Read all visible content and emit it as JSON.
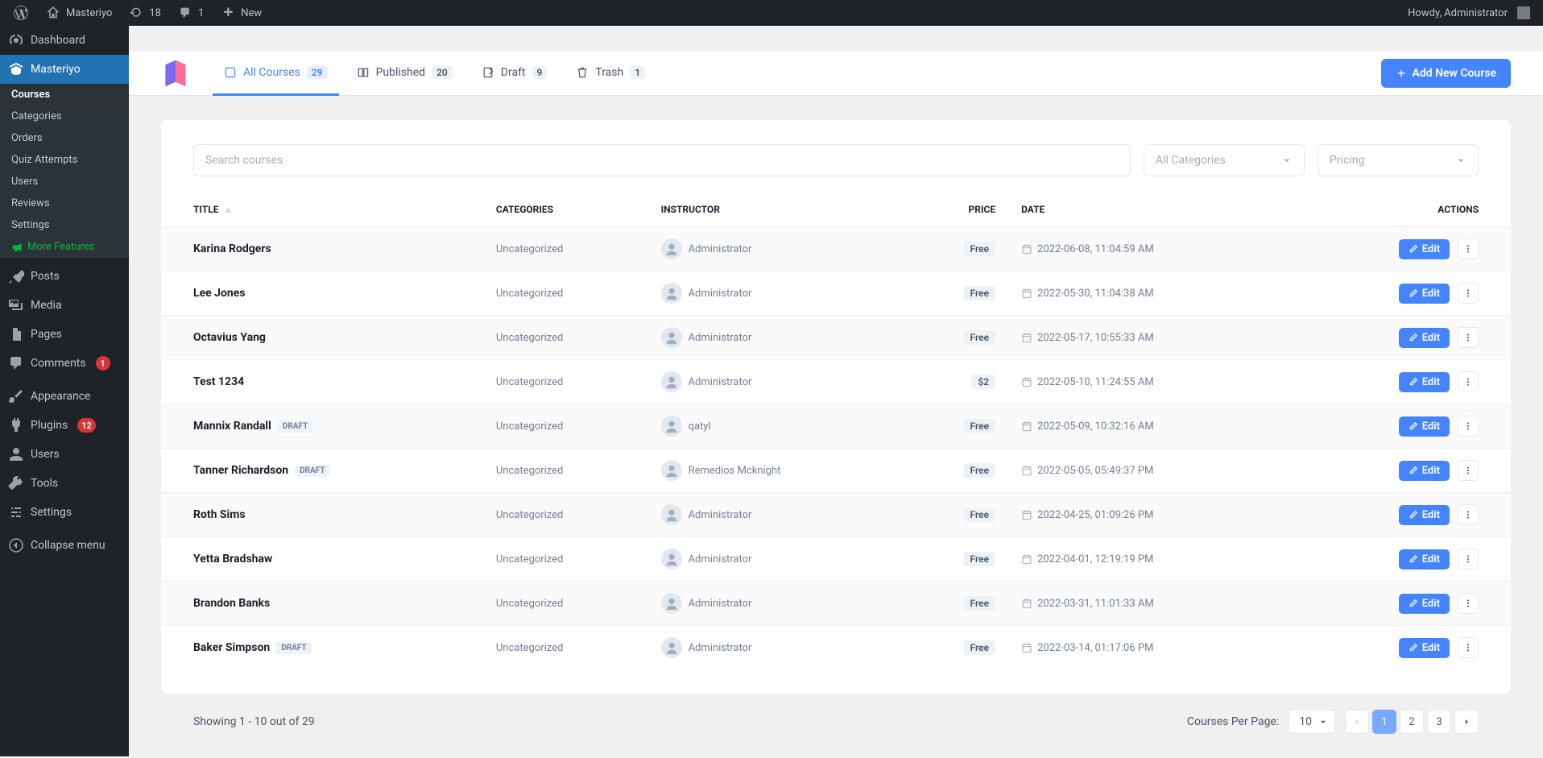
{
  "adminbar": {
    "site": "Masteriyo",
    "updates": "18",
    "comments": "1",
    "new": "New",
    "howdy": "Howdy, Administrator"
  },
  "sidebar": {
    "dashboard": "Dashboard",
    "masteriyo": "Masteriyo",
    "sub": {
      "courses": "Courses",
      "categories": "Categories",
      "orders": "Orders",
      "quiz": "Quiz Attempts",
      "users": "Users",
      "reviews": "Reviews",
      "settings": "Settings",
      "more": "More Features"
    },
    "posts": "Posts",
    "media": "Media",
    "pages": "Pages",
    "comments": "Comments",
    "comments_count": "1",
    "appearance": "Appearance",
    "plugins": "Plugins",
    "plugins_count": "12",
    "wpusers": "Users",
    "tools": "Tools",
    "wpsettings": "Settings",
    "collapse": "Collapse menu"
  },
  "tabs": {
    "all": {
      "label": "All Courses",
      "count": "29"
    },
    "published": {
      "label": "Published",
      "count": "20"
    },
    "draft": {
      "label": "Draft",
      "count": "9"
    },
    "trash": {
      "label": "Trash",
      "count": "1"
    }
  },
  "addNew": "Add New Course",
  "filters": {
    "search_placeholder": "Search courses",
    "categories": "All Categories",
    "pricing": "Pricing"
  },
  "columns": {
    "title": "TITLE",
    "categories": "CATEGORIES",
    "instructor": "INSTRUCTOR",
    "price": "PRICE",
    "date": "DATE",
    "actions": "ACTIONS"
  },
  "rows": [
    {
      "title": "Karina Rodgers",
      "draft": false,
      "cat": "Uncategorized",
      "instructor": "Administrator",
      "price": "Free",
      "date": "2022-06-08, 11:04:59 AM"
    },
    {
      "title": "Lee Jones",
      "draft": false,
      "cat": "Uncategorized",
      "instructor": "Administrator",
      "price": "Free",
      "date": "2022-05-30, 11:04:38 AM"
    },
    {
      "title": "Octavius Yang",
      "draft": false,
      "cat": "Uncategorized",
      "instructor": "Administrator",
      "price": "Free",
      "date": "2022-05-17, 10:55:33 AM"
    },
    {
      "title": "Test 1234",
      "draft": false,
      "cat": "Uncategorized",
      "instructor": "Administrator",
      "price": "$2",
      "date": "2022-05-10, 11:24:55 AM"
    },
    {
      "title": "Mannix Randall",
      "draft": true,
      "cat": "Uncategorized",
      "instructor": "qatyl",
      "price": "Free",
      "date": "2022-05-09, 10:32:16 AM"
    },
    {
      "title": "Tanner Richardson",
      "draft": true,
      "cat": "Uncategorized",
      "instructor": "Remedios Mcknight",
      "price": "Free",
      "date": "2022-05-05, 05:49:37 PM"
    },
    {
      "title": "Roth Sims",
      "draft": false,
      "cat": "Uncategorized",
      "instructor": "Administrator",
      "price": "Free",
      "date": "2022-04-25, 01:09:26 PM"
    },
    {
      "title": "Yetta Bradshaw",
      "draft": false,
      "cat": "Uncategorized",
      "instructor": "Administrator",
      "price": "Free",
      "date": "2022-04-01, 12:19:19 PM"
    },
    {
      "title": "Brandon Banks",
      "draft": false,
      "cat": "Uncategorized",
      "instructor": "Administrator",
      "price": "Free",
      "date": "2022-03-31, 11:01:33 AM"
    },
    {
      "title": "Baker Simpson",
      "draft": true,
      "cat": "Uncategorized",
      "instructor": "Administrator",
      "price": "Free",
      "date": "2022-03-14, 01:17:06 PM"
    }
  ],
  "draftLabel": "DRAFT",
  "editLabel": "Edit",
  "footer": {
    "showing": "Showing 1 - 10 out of 29",
    "perPageLabel": "Courses Per Page:",
    "perPage": "10",
    "pages": [
      "1",
      "2",
      "3"
    ]
  }
}
